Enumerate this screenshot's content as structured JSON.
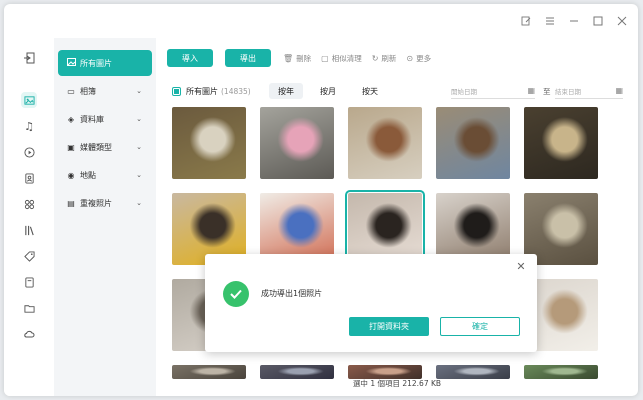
{
  "window": {
    "controls": [
      "edit-icon",
      "menu-icon",
      "minimize-icon",
      "maximize-icon",
      "close-icon"
    ]
  },
  "rail": {
    "icons": [
      "exit-icon",
      "photo-icon",
      "music-icon",
      "video-icon",
      "contacts-icon",
      "apps-icon",
      "books-icon",
      "tag-icon",
      "file-icon",
      "folder-icon",
      "cloud-icon"
    ],
    "active_index": 1
  },
  "nav": {
    "items": [
      {
        "label": "所有圖片",
        "icon": "image-icon",
        "active": true,
        "has_chevron": false
      },
      {
        "label": "相簿",
        "icon": "album-icon",
        "active": false,
        "has_chevron": true
      },
      {
        "label": "資料庫",
        "icon": "database-icon",
        "active": false,
        "has_chevron": true
      },
      {
        "label": "媒體類型",
        "icon": "media-type-icon",
        "active": false,
        "has_chevron": true
      },
      {
        "label": "地點",
        "icon": "location-icon",
        "active": false,
        "has_chevron": true
      },
      {
        "label": "重複照片",
        "icon": "duplicate-icon",
        "active": false,
        "has_chevron": true
      }
    ]
  },
  "toolbar": {
    "import_label": "導入",
    "export_label": "導出",
    "delete_label": "刪除",
    "similar_label": "相似清理",
    "refresh_label": "刷新",
    "more_label": "更多"
  },
  "filter": {
    "title": "所有圖片",
    "count": "(14835)",
    "by_year": "按年",
    "by_month": "按月",
    "by_day": "按天",
    "start_date_placeholder": "開始日期",
    "date_separator": "至",
    "end_date_placeholder": "結束日期"
  },
  "photos": [
    {
      "row": 0,
      "col": 0,
      "desc": "food-bowls",
      "colors": [
        "#6b5a3e",
        "#d9d2c0",
        "#8a7a4a"
      ]
    },
    {
      "row": 0,
      "col": 1,
      "desc": "girl-pink-hat",
      "colors": [
        "#a4a39c",
        "#e6a3b8",
        "#5c5a55"
      ]
    },
    {
      "row": 0,
      "col": 2,
      "desc": "street-coat",
      "colors": [
        "#b9a88c",
        "#8a5a3a",
        "#d7cfc0"
      ]
    },
    {
      "row": 0,
      "col": 3,
      "desc": "brown-jacket-street",
      "colors": [
        "#9a8c76",
        "#6a4d35",
        "#6f86a0"
      ]
    },
    {
      "row": 0,
      "col": 4,
      "desc": "sitting-sunset",
      "colors": [
        "#4a4030",
        "#c8b48a",
        "#2d2820"
      ]
    },
    {
      "row": 1,
      "col": 0,
      "desc": "city-taxi",
      "colors": [
        "#c9b8a0",
        "#3a3028",
        "#e0b020"
      ]
    },
    {
      "row": 1,
      "col": 1,
      "desc": "phone-screen",
      "colors": [
        "#f0ece6",
        "#4a70c0",
        "#d06a50"
      ]
    },
    {
      "row": 1,
      "col": 2,
      "desc": "mirror-selfie",
      "colors": [
        "#c4b8ac",
        "#2a2420",
        "#e8ded6"
      ],
      "selected": true
    },
    {
      "row": 1,
      "col": 3,
      "desc": "black-dress-selfie",
      "colors": [
        "#d8d2cb",
        "#1f1c1a",
        "#8c7a6a"
      ]
    },
    {
      "row": 1,
      "col": 4,
      "desc": "blazer-room",
      "colors": [
        "#8a806e",
        "#c9c0a8",
        "#5a5040"
      ]
    },
    {
      "row": 2,
      "col": 0,
      "desc": "room-interior",
      "colors": [
        "#b0aaa0",
        "#6a6258",
        "#d6d0c8"
      ]
    },
    {
      "row": 2,
      "col": 4,
      "desc": "white-outfit",
      "colors": [
        "#dcd6ce",
        "#b59a7a",
        "#f2efe9"
      ]
    },
    {
      "row": 3,
      "col": 0,
      "desc": "partial-1",
      "colors": [
        "#7a7266",
        "#bdb4a6",
        "#4a443c"
      ]
    },
    {
      "row": 3,
      "col": 1,
      "desc": "partial-2",
      "colors": [
        "#5a5a66",
        "#9aa0b0",
        "#303040"
      ]
    },
    {
      "row": 3,
      "col": 2,
      "desc": "partial-3",
      "colors": [
        "#8a5a4a",
        "#c9a08a",
        "#40302a"
      ]
    },
    {
      "row": 3,
      "col": 3,
      "desc": "partial-4",
      "colors": [
        "#6a7080",
        "#b0b6c0",
        "#3a3e48"
      ]
    },
    {
      "row": 3,
      "col": 4,
      "desc": "partial-5",
      "colors": [
        "#6a8a5a",
        "#a0b890",
        "#3a4a30"
      ]
    }
  ],
  "status": {
    "text": "選中 1 個項目 212.67 KB"
  },
  "dialog": {
    "message": "成功導出1個照片",
    "open_folder_label": "打開資料夾",
    "ok_label": "確定",
    "success_color": "#37c26c",
    "accent": "#19b3a8"
  }
}
